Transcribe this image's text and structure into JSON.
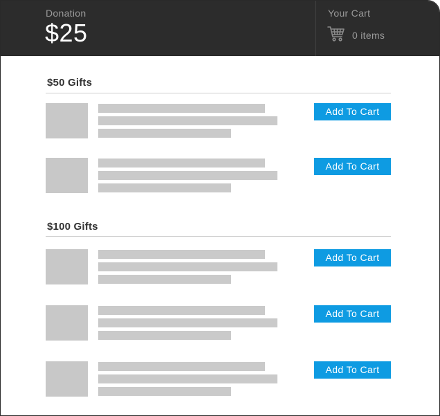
{
  "header": {
    "donation_label": "Donation",
    "donation_amount": "$25",
    "cart_label": "Your Cart",
    "cart_icon": "shopping-cart-icon",
    "cart_count": "0 items"
  },
  "sections": [
    {
      "title": "$50 Gifts",
      "items": [
        {
          "button_label": "Add To Cart"
        },
        {
          "button_label": "Add To Cart"
        }
      ]
    },
    {
      "title": "$100 Gifts",
      "items": [
        {
          "button_label": "Add To Cart"
        },
        {
          "button_label": "Add To Cart"
        },
        {
          "button_label": "Add To Cart"
        }
      ]
    }
  ],
  "colors": {
    "header_bg": "#2c2c2c",
    "button_bg": "#0e9be2",
    "placeholder": "#c8c8c8"
  }
}
